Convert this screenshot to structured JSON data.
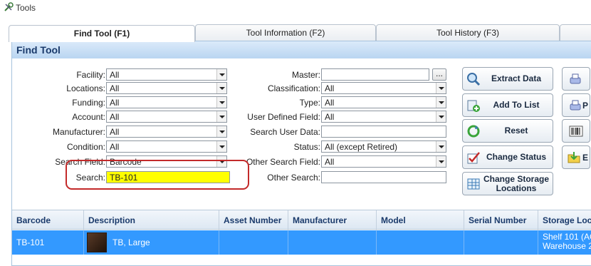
{
  "window": {
    "title": "Tools",
    "icon": "tools-icon"
  },
  "tabs": [
    {
      "label": "Find Tool (F1)",
      "active": true
    },
    {
      "label": "Tool Information (F2)",
      "active": false
    },
    {
      "label": "Tool History (F3)",
      "active": false
    }
  ],
  "panel": {
    "title": "Find Tool"
  },
  "form_left": {
    "facility": {
      "label": "Facility:",
      "value": "All"
    },
    "locations": {
      "label": "Locations:",
      "value": "All"
    },
    "funding": {
      "label": "Funding:",
      "value": "All"
    },
    "account": {
      "label": "Account:",
      "value": "All"
    },
    "manufacturer": {
      "label": "Manufacturer:",
      "value": "All"
    },
    "condition": {
      "label": "Condition:",
      "value": "All"
    },
    "search_field": {
      "label": "Search Field:",
      "value": "Barcode"
    },
    "search": {
      "label": "Search:",
      "value": "TB-101"
    }
  },
  "form_right": {
    "master": {
      "label": "Master:",
      "value": "",
      "browse": "..."
    },
    "classification": {
      "label": "Classification:",
      "value": "All"
    },
    "type": {
      "label": "Type:",
      "value": "All"
    },
    "user_defined_field": {
      "label": "User Defined Field:",
      "value": "All"
    },
    "search_user_data": {
      "label": "Search User Data:",
      "value": ""
    },
    "status": {
      "label": "Status:",
      "value": "All  (except Retired)"
    },
    "other_search_field": {
      "label": "Other Search Field:",
      "value": "All"
    },
    "other_search": {
      "label": "Other Search:",
      "value": ""
    }
  },
  "buttons": {
    "extract_data": "Extract Data",
    "add_to_list": "Add To List",
    "reset": "Reset",
    "change_status": "Change Status",
    "change_storage_line1": "Change Storage",
    "change_storage_line2": "Locations",
    "side_p": "P",
    "side_e": "E"
  },
  "grid": {
    "columns": [
      "Barcode",
      "Description",
      "Asset Number",
      "Manufacturer",
      "Model",
      "Serial Number",
      "Storage Loc"
    ],
    "rows": [
      {
        "barcode": "TB-101",
        "description": "TB, Large",
        "asset_number": "",
        "manufacturer": "",
        "model": "",
        "serial_number": "",
        "storage_line1": "Shelf 101 (AC",
        "storage_line2": "Warehouse 2"
      }
    ]
  },
  "colors": {
    "selected_row": "#3399ff",
    "search_highlight": "#ffff00",
    "callout": "#c32a2a",
    "header_text": "#1a3a6b"
  }
}
